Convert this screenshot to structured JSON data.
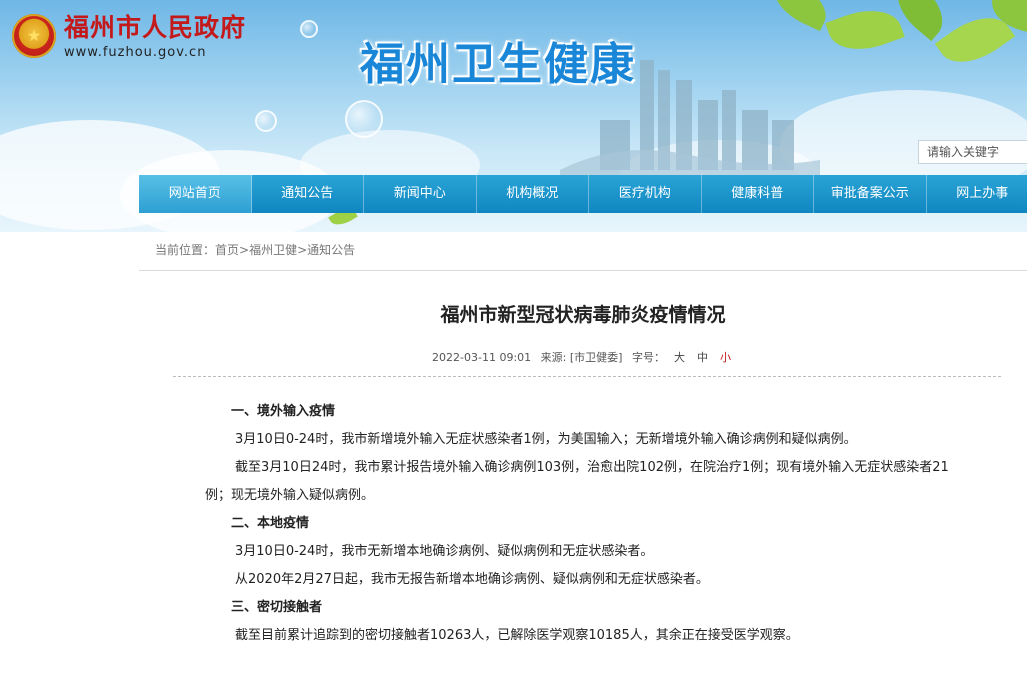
{
  "header": {
    "gov_title": "福州市人民政府",
    "gov_url": "www.fuzhou.gov.cn",
    "site_title": "福州卫生健康"
  },
  "search": {
    "placeholder": "请输入关键字"
  },
  "nav": {
    "items": [
      "网站首页",
      "通知公告",
      "新闻中心",
      "机构概况",
      "医疗机构",
      "健康科普",
      "审批备案公示",
      "网上办事"
    ]
  },
  "breadcrumb": {
    "prefix": "当前位置：",
    "items": [
      "首页",
      "福州卫健",
      "通知公告"
    ],
    "sep": ">"
  },
  "article": {
    "title": "福州市新型冠状病毒肺炎疫情情况",
    "date": "2022-03-11 09:01",
    "source": "来源: [市卫健委]",
    "fontsize_label": "字号：",
    "size_large": "大",
    "size_medium": "中",
    "size_small": "小",
    "paragraphs": [
      "一、境外输入疫情",
      "3月10日0-24时，我市新增境外输入无症状感染者1例，为美国输入；无新增境外输入确诊病例和疑似病例。",
      "截至3月10日24时，我市累计报告境外输入确诊病例103例，治愈出院102例，在院治疗1例；现有境外输入无症状感染者21例；现无境外输入疑似病例。",
      "二、本地疫情",
      "3月10日0-24时，我市无新增本地确诊病例、疑似病例和无症状感染者。",
      "从2020年2月27日起，我市无报告新增本地确诊病例、疑似病例和无症状感染者。",
      "三、密切接触者",
      "截至目前累计追踪到的密切接触者10263人，已解除医学观察10185人，其余正在接受医学观察。"
    ]
  },
  "colors": {
    "accent": "#0f86c0",
    "gov_red": "#c4191b",
    "site_blue": "#1a86d8"
  }
}
